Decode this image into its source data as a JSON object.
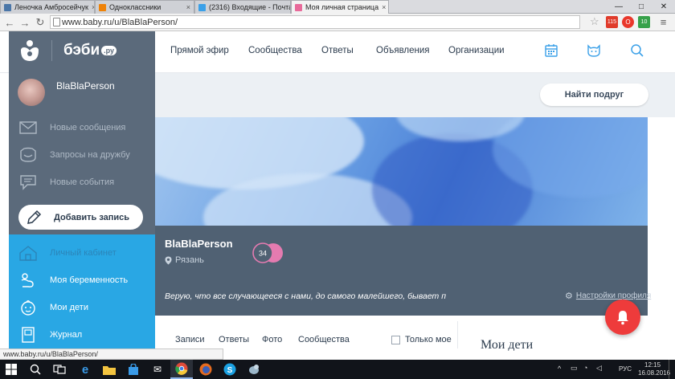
{
  "browser": {
    "tabs": [
      {
        "label": "Леночка Амбросейчук",
        "favicon_color": "#4a76a8",
        "favicon_letter": "В"
      },
      {
        "label": "Одноклассники",
        "favicon_color": "#ee8208",
        "favicon_letter": "О"
      },
      {
        "label": "(2316) Входящие - Почта",
        "favicon_color": "#3aa0e8",
        "favicon_letter": "@"
      },
      {
        "label": "Моя личная страница",
        "favicon_color": "#e86a9a",
        "favicon_letter": "♥"
      }
    ],
    "close_glyph": "×",
    "window_controls": [
      "—",
      "□",
      "✕"
    ],
    "url": "www.baby.ru/u/BlaBlaPerson/",
    "ext_badge_1": "115",
    "ext_badge_2": "10"
  },
  "header": {
    "nav": [
      "Прямой эфир",
      "Сообщества",
      "Ответы",
      "Объявления",
      "Организации"
    ],
    "icons": [
      "calendar-icon",
      "cat-face-icon",
      "search-icon"
    ]
  },
  "sidebar": {
    "logo_text": "бэби",
    "logo_suffix": ".ру",
    "username": "BlaBlaPerson",
    "items_top": [
      {
        "label": "Новые сообщения",
        "icon": "envelope-icon"
      },
      {
        "label": "Запросы на дружбу",
        "icon": "friend-request-icon"
      },
      {
        "label": "Новые события",
        "icon": "speech-bubble-icon"
      }
    ],
    "add_post": "Добавить запись",
    "items_bottom": [
      {
        "label": "Личный кабинет",
        "icon": "house-icon"
      },
      {
        "label": "Моя беременность",
        "icon": "pregnancy-icon"
      },
      {
        "label": "Мои дети",
        "icon": "baby-face-icon"
      },
      {
        "label": "Журнал",
        "icon": "journal-icon"
      }
    ]
  },
  "profile": {
    "find_friends": "Найти подруг",
    "name": "BlaBlaPerson",
    "city": "Рязань",
    "badge_number": "34",
    "quote": "Верую, что все случающееся с нами, до самого малейшего, бывает п",
    "settings_link": "Настройки профиля",
    "tabs": [
      "Записи",
      "Ответы",
      "Фото",
      "Сообщества"
    ],
    "only_mine": "Только мое",
    "kids_heading": "Мои дети"
  },
  "status_url": "www.baby.ru/u/BlaBlaPerson/",
  "taskbar": {
    "lang": "РУС",
    "time": "12:15",
    "date": "16.08.2016"
  }
}
